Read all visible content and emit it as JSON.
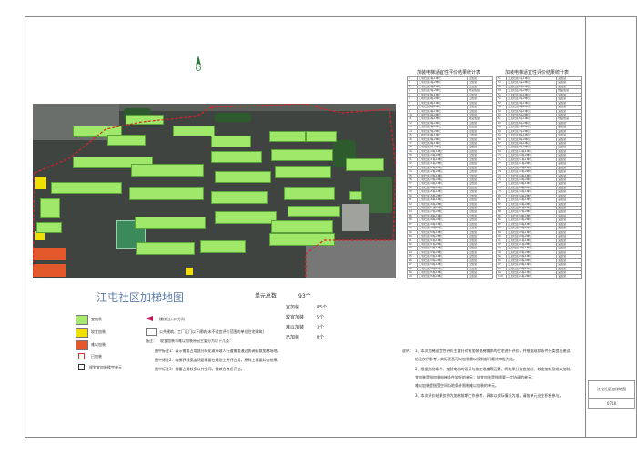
{
  "map_title": "江屯社区加梯地图",
  "summary": [
    {
      "label": "单元总数",
      "value": "93个"
    },
    {
      "label": "宜加装",
      "value": "85个"
    },
    {
      "label": "较宜加装",
      "value": "5个"
    },
    {
      "label": "难以加装",
      "value": "3个"
    },
    {
      "label": "已加装",
      "value": "0个"
    }
  ],
  "legend": [
    {
      "label": "宜加装",
      "color": "#a6e872"
    },
    {
      "label": "较宜加装",
      "color": "#f0e000"
    },
    {
      "label": "难以加装",
      "color": "#e3592b"
    },
    {
      "label": "已加装",
      "color": "#ffffff"
    },
    {
      "label": "规划宜加装楼宇单元",
      "color": "#ffffff"
    }
  ],
  "legend_right": [
    "楼梯出入口方向",
    "公共建筑、工厂区门以下建筑(未不适宜评价范围的单位住宅建筑)"
  ],
  "remark_head": "备注：",
  "remarks": [
    "较宜加装与难以加装原因主要分为以下几类：",
    "图中标注1：表示需要占用部分绿化或市政人行道需要通过协调获取加梯场地。",
    "图中标注2：临街界线宽度问题需要在规划上另行占用，原则上需要综合统筹。",
    "图中标注3：需要占用较多公共空间，需综合考虑评估。"
  ],
  "table1_title": "加装电梯适宜性评价结果统计表",
  "table2_title": "加装电梯适宜性评价结果统计表",
  "table_rows1": [
    "江屯社区1栋1单元",
    "江屯社区1栋2单元",
    "江屯社区2栋1单元",
    "江屯社区2栋2单元",
    "江屯社区3栋1单元",
    "江屯社区3栋2单元",
    "江屯社区4栋1单元",
    "江屯社区4栋2单元",
    "江屯社区5栋1单元",
    "江屯社区5栋2单元",
    "江屯社区6栋1单元",
    "江屯社区6栋2单元",
    "江屯社区7栋1单元",
    "江屯社区7栋2单元",
    "江屯社区8栋1单元",
    "江屯社区8栋2单元",
    "江屯社区9栋1单元",
    "江屯社区9栋2单元",
    "江屯社区10栋1单元",
    "江屯社区10栋2单元",
    "江屯社区11栋1单元",
    "江屯社区11栋2单元",
    "江屯社区12栋1单元",
    "江屯社区12栋2单元",
    "江屯社区13栋1单元",
    "江屯社区13栋2单元",
    "江屯社区14栋1单元",
    "江屯社区14栋2单元",
    "江屯社区15栋1单元",
    "江屯社区15栋2单元",
    "江屯社区16栋1单元",
    "江屯社区16栋2单元",
    "江屯社区17栋1单元",
    "江屯社区17栋2单元",
    "江屯社区18栋1单元",
    "江屯社区18栋2单元",
    "江屯社区19栋1单元",
    "江屯社区19栋2单元",
    "江屯社区20栋1单元",
    "江屯社区20栋2单元",
    "江屯社区21栋1单元",
    "江屯社区21栋2单元",
    "江屯社区22栋1单元",
    "江屯社区22栋2单元",
    "江屯社区23栋1单元",
    "江屯社区23栋2单元",
    "江屯社区24栋1单元",
    "江屯社区24栋2单元",
    "江屯社区25栋1单元",
    "江屯社区25栋2单元"
  ],
  "table_values": [
    "宜加装",
    "宜加装",
    "宜加装",
    "较宜加装",
    "宜加装",
    "宜加装",
    "宜加装",
    "宜加装",
    "宜加装",
    "宜加装",
    "较宜加装",
    "宜加装",
    "宜加装",
    "宜加装",
    "宜加装",
    "宜加装",
    "宜加装",
    "宜加装",
    "宜加装",
    "宜加装",
    "宜加装",
    "宜加装",
    "宜加装",
    "宜加装",
    "宜加装",
    "宜加装",
    "宜加装",
    "宜加装",
    "宜加装",
    "宜加装",
    "宜加装",
    "宜加装",
    "宜加装",
    "宜加装",
    "宜加装",
    "宜加装",
    "宜加装",
    "宜加装",
    "宜加装",
    "宜加装",
    "宜加装",
    "宜加装",
    "宜加装",
    "宜加装",
    "宜加装",
    "宜加装",
    "宜加装",
    "宜加装",
    "宜加装",
    "宜加装"
  ],
  "notes_head": "说明：",
  "notes": [
    "1、本次加梯适宜性评价主要针对有加装电梯需求的住宅进行评价，并根据现状条件分类提出建议。",
    "   结论仅供参考，实际是否可以加装需以规划部门最终审批为准。",
    "2、根据加梯条件、加装电梯的设计与施工难度等因素，将结果分为宜加装、较宜加装及难以加装。",
    "   宜加装是指加装电梯条件较好的单元；较宜加装是指需要一定协调的单元；",
    "   难以加装是指受空间场地条件限制难以加装的单元。",
    "3、本次评价结果仅作为加梯前期工作参考，具体以实际情况为准，请各单元业主积极参与。"
  ],
  "titleblock": {
    "name": "江屯社区加梯地图",
    "code": "0718"
  }
}
